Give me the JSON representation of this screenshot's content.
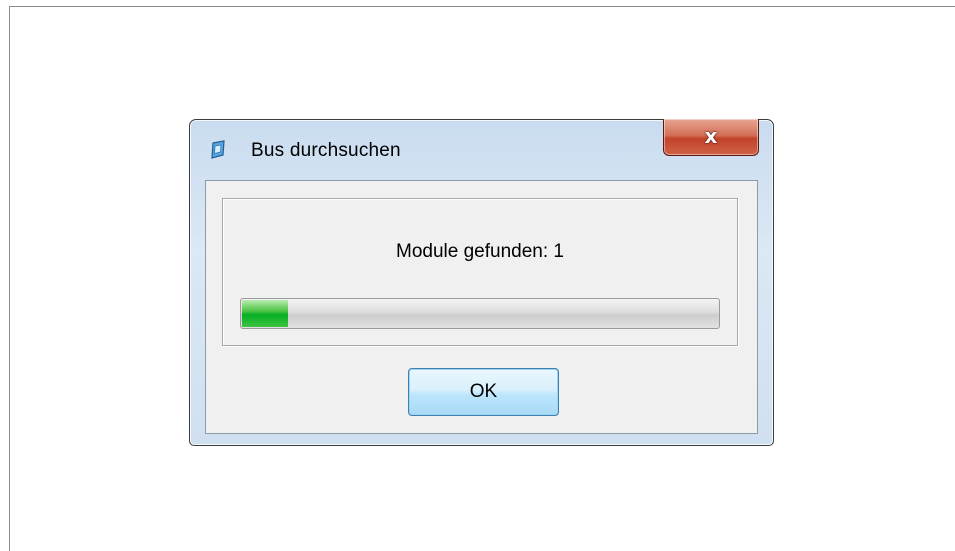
{
  "dialog": {
    "title": "Bus durchsuchen",
    "app_icon": "app-window-icon",
    "close_icon": "close-icon",
    "close_label": "x"
  },
  "content": {
    "status_text": "Module gefunden: 1",
    "progress_fraction": 0.1,
    "progress_color": "#06b025"
  },
  "buttons": {
    "ok_label": "OK"
  }
}
